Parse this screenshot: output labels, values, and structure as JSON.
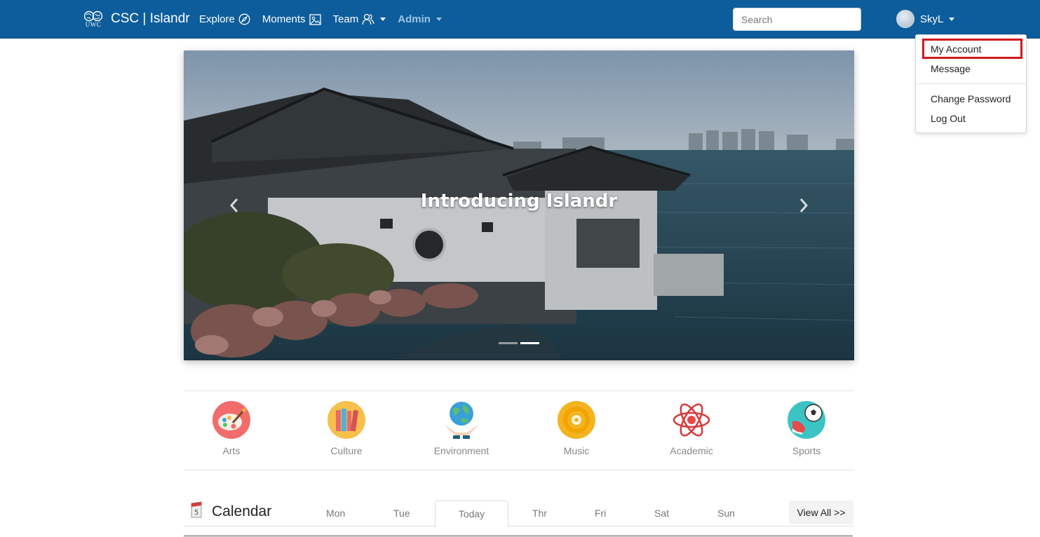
{
  "navbar": {
    "brand_logo_text": "UWC",
    "brand_title": "CSC | Islandr",
    "items": [
      {
        "label": "Explore",
        "icon": "compass-icon"
      },
      {
        "label": "Moments",
        "icon": "image-icon"
      },
      {
        "label": "Team",
        "icon": "people-icon"
      },
      {
        "label": "Admin",
        "icon": null
      }
    ],
    "search_placeholder": "Search",
    "user_name": "SkyL",
    "colors": {
      "bar": "#0d5d9c",
      "admin_text": "#9fc2e0"
    }
  },
  "user_menu": {
    "items": [
      {
        "label": "My Account",
        "highlighted": true
      },
      {
        "label": "Message"
      },
      {
        "label": "Change Password"
      },
      {
        "label": "Log Out"
      }
    ],
    "highlight_color": "#d11a1a"
  },
  "carousel": {
    "caption": "Introducing Islandr",
    "slide_count": 2,
    "active_slide": 2
  },
  "categories": [
    {
      "label": "Arts",
      "icon": "palette-icon"
    },
    {
      "label": "Culture",
      "icon": "books-icon"
    },
    {
      "label": "Environment",
      "icon": "globe-hands-icon"
    },
    {
      "label": "Music",
      "icon": "vinyl-record-icon"
    },
    {
      "label": "Academic",
      "icon": "atom-icon"
    },
    {
      "label": "Sports",
      "icon": "soccer-icon"
    }
  ],
  "calendar": {
    "title": "Calendar",
    "tabs": [
      "Mon",
      "Tue",
      "Today",
      "Thr",
      "Fri",
      "Sat",
      "Sun"
    ],
    "active_tab": "Today",
    "view_all": "View All >>"
  }
}
